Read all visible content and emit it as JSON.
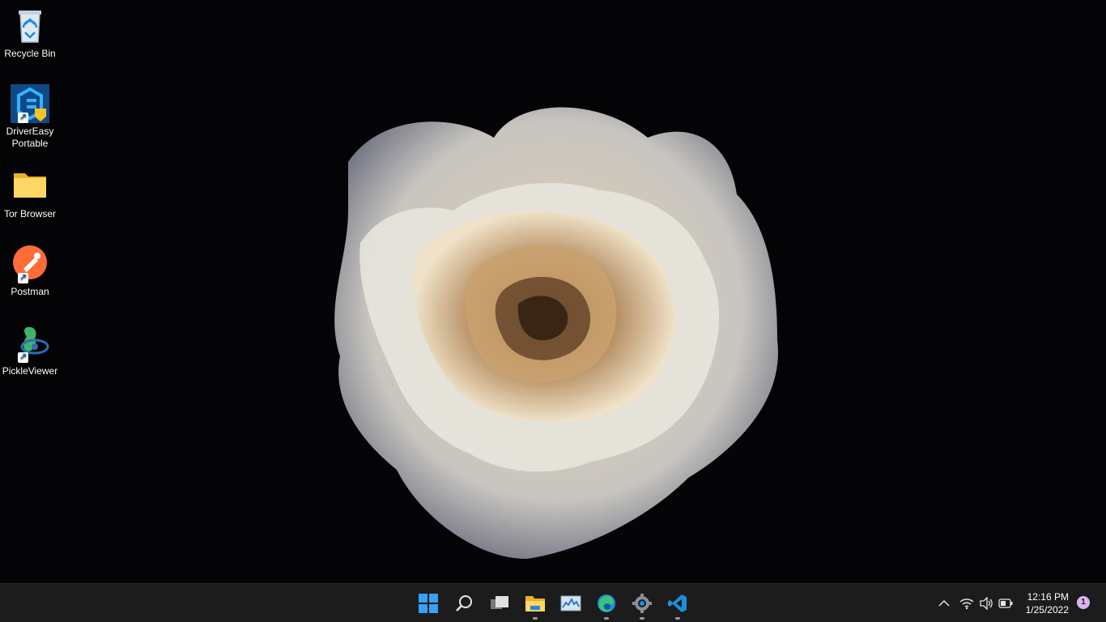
{
  "desktop": {
    "icons": [
      {
        "label": "Recycle Bin"
      },
      {
        "label": "DriverEasy\nPortable"
      },
      {
        "label": "Tor Browser"
      },
      {
        "label": "Postman"
      },
      {
        "label": "PickleViewer"
      }
    ]
  },
  "taskbar": {
    "apps": [
      {
        "name": "start-icon"
      },
      {
        "name": "search-icon"
      },
      {
        "name": "task-view-icon"
      },
      {
        "name": "file-explorer-icon"
      },
      {
        "name": "resource-monitor-icon"
      },
      {
        "name": "edge-icon"
      },
      {
        "name": "settings-icon"
      },
      {
        "name": "vscode-icon"
      }
    ],
    "tray": {
      "time": "12:16 PM",
      "date": "1/25/2022",
      "notification_count": "1"
    }
  }
}
